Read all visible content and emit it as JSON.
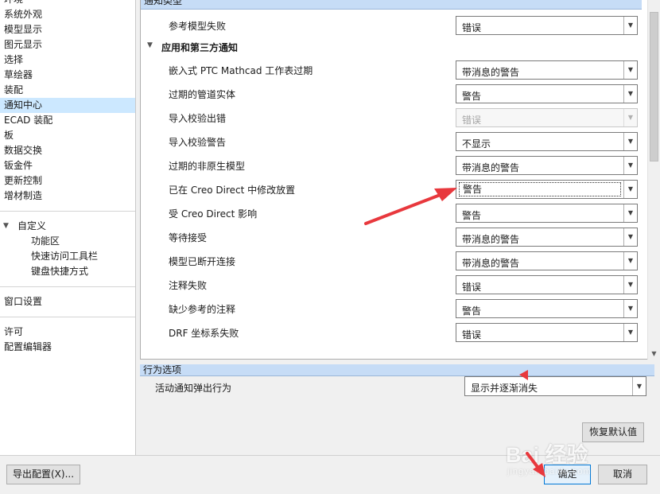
{
  "sidebar": {
    "categories": [
      {
        "label": "环境"
      },
      {
        "label": "系统外观"
      },
      {
        "label": "模型显示"
      },
      {
        "label": "图元显示"
      },
      {
        "label": "选择"
      },
      {
        "label": "草绘器"
      },
      {
        "label": "装配"
      },
      {
        "label": "通知中心"
      },
      {
        "label": "ECAD 装配"
      },
      {
        "label": "板"
      },
      {
        "label": "数据交换"
      },
      {
        "label": "钣金件"
      },
      {
        "label": "更新控制"
      },
      {
        "label": "增材制造"
      }
    ],
    "customize": {
      "label": "自定义",
      "children": [
        {
          "label": "功能区"
        },
        {
          "label": "快速访问工具栏"
        },
        {
          "label": "键盘快捷方式"
        }
      ]
    },
    "window_settings": "窗口设置",
    "license": "许可",
    "config_editor": "配置编辑器"
  },
  "main": {
    "header": "通知类型",
    "top_row": {
      "label": "参考模型失败",
      "value": "错误"
    },
    "group_title": "应用和第三方通知",
    "rows": [
      {
        "label": "嵌入式 PTC  Mathcad 工作表过期",
        "value": "带消息的警告"
      },
      {
        "label": "过期的管道实体",
        "value": "警告"
      },
      {
        "label": "导入校验出错",
        "value": "错误"
      },
      {
        "label": "导入校验警告",
        "value": "不显示"
      },
      {
        "label": "过期的非原生模型",
        "value": "带消息的警告"
      },
      {
        "label": "已在 Creo Direct 中修改放置",
        "value": "警告"
      },
      {
        "label": "受 Creo Direct 影响",
        "value": "警告"
      },
      {
        "label": "等待接受",
        "value": "带消息的警告"
      },
      {
        "label": "模型已断开连接",
        "value": "带消息的警告"
      },
      {
        "label": "注释失败",
        "value": "错误"
      },
      {
        "label": "缺少参考的注释",
        "value": "警告"
      },
      {
        "label": "DRF 坐标系失败",
        "value": "错误"
      }
    ]
  },
  "behavior": {
    "header": "行为选项",
    "label": "活动通知弹出行为",
    "value": "显示并逐渐消失"
  },
  "buttons": {
    "restore_defaults": "恢复默认值",
    "export_config": "导出配置(X)...",
    "ok": "确定",
    "cancel": "取消"
  },
  "watermark": {
    "main": "Bai 经验",
    "sub": "jingyan.baidu.com"
  },
  "colors": {
    "selection": "#cce8ff",
    "section_header": "#c6dcf6",
    "annotation_arrow": "#e8383d",
    "primary_border": "#0078d7"
  }
}
